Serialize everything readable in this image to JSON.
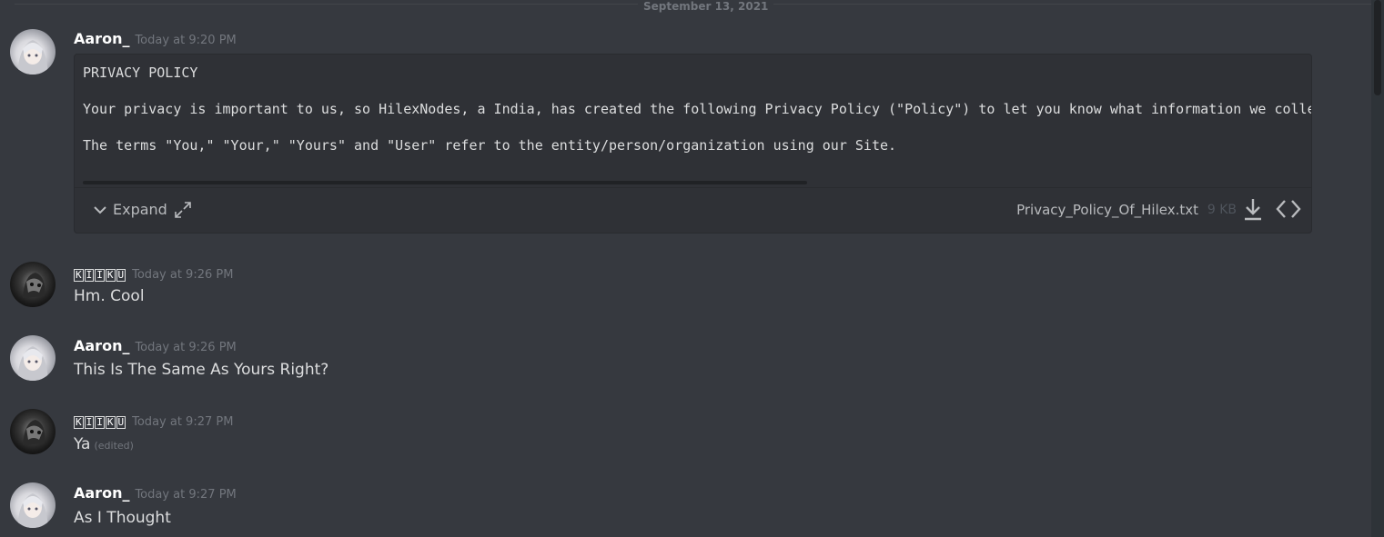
{
  "divider": {
    "date": "September 13, 2021"
  },
  "messages": [
    {
      "author": "Aaron_",
      "time": "Today at 9:20 PM",
      "avatar": "anime-girl-avatar"
    },
    {
      "author": "KIIKU",
      "time": "Today at 9:26 PM",
      "text": "Hm. Cool",
      "avatar": "dark-mask-avatar"
    },
    {
      "author": "Aaron_",
      "time": "Today at 9:26 PM",
      "text": "This Is The Same As Yours Right?",
      "avatar": "anime-girl-avatar"
    },
    {
      "author": "KIIKU",
      "time": "Today at 9:27 PM",
      "text": "Ya",
      "edited": "(edited)",
      "avatar": "dark-mask-avatar"
    },
    {
      "author": "Aaron_",
      "time": "Today at 9:27 PM",
      "text": "As I Thought",
      "avatar": "anime-girl-avatar"
    }
  ],
  "attachment": {
    "lines": [
      "PRIVACY POLICY",
      "Your privacy is important to us, so HilexNodes, a India, has created the following Privacy Policy (\"Policy\") to let you know what information we collect",
      "The terms \"You,\" \"Your,\" \"Yours\" and \"User\" refer to the entity/person/organization using our Site."
    ],
    "expand_label": "Expand",
    "file_name": "Privacy_Policy_Of_Hilex.txt",
    "file_size": "9 KB"
  }
}
